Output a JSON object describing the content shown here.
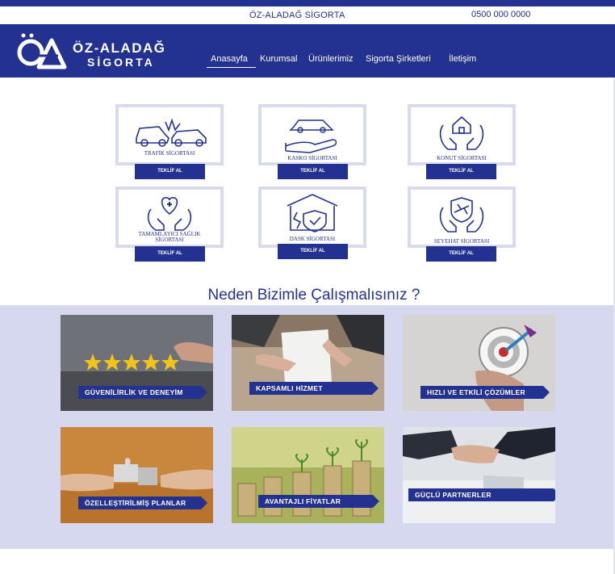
{
  "topbar": {
    "brand": "ÖZ-ALADAĞ SİGORTA",
    "phone": "0500 000 0000"
  },
  "logo": {
    "line1": "ÖZ-ALADAĞ",
    "line2": "SİGORTA"
  },
  "nav": {
    "items": [
      "Anasayfa",
      "Kurumsal",
      "Ürünlerimiz",
      "Sigorta Şirketleri",
      "İletişim"
    ],
    "active": "Anasayfa"
  },
  "products": [
    {
      "title": "TRAFİK SİGORTASI",
      "button": "TEKLİF AL",
      "icon": "car-crash-icon"
    },
    {
      "title": "KASKO SİGORTASI",
      "button": "TEKLİF AL",
      "icon": "car-hand-icon"
    },
    {
      "title": "KONUT SİGORTASI",
      "button": "TEKLİF AL",
      "icon": "house-hands-icon"
    },
    {
      "title_line1": "TAMAMLAYICI SAĞLIK",
      "title_line2": "SİGORTASI",
      "button": "TEKLİF AL",
      "icon": "heart-hands-icon"
    },
    {
      "title": "DASK SİGORTASI",
      "button": "TEKLİF AL",
      "icon": "house-shield-icon"
    },
    {
      "title": "SEYEHAT SİGORTASI",
      "button": "TEKLİF AL",
      "icon": "plane-shield-icon"
    }
  ],
  "why": {
    "title": "Neden Bizimle Çalışmalısınız ?",
    "tiles": [
      "GÜVENİLİRLİK VE DENEYİM",
      "KAPSAMLI HİZMET",
      "HIZLI VE ETKİLİ ÇÖZÜMLER",
      "ÖZELLEŞTİRİLMİŞ PLANLAR",
      "AVANTAJLI FİYATLAR",
      "GÜÇLÜ PARTNERLER"
    ]
  },
  "colors": {
    "primary": "#233190",
    "card_border": "#d8dbed",
    "section_bg": "#d5d8ee"
  }
}
